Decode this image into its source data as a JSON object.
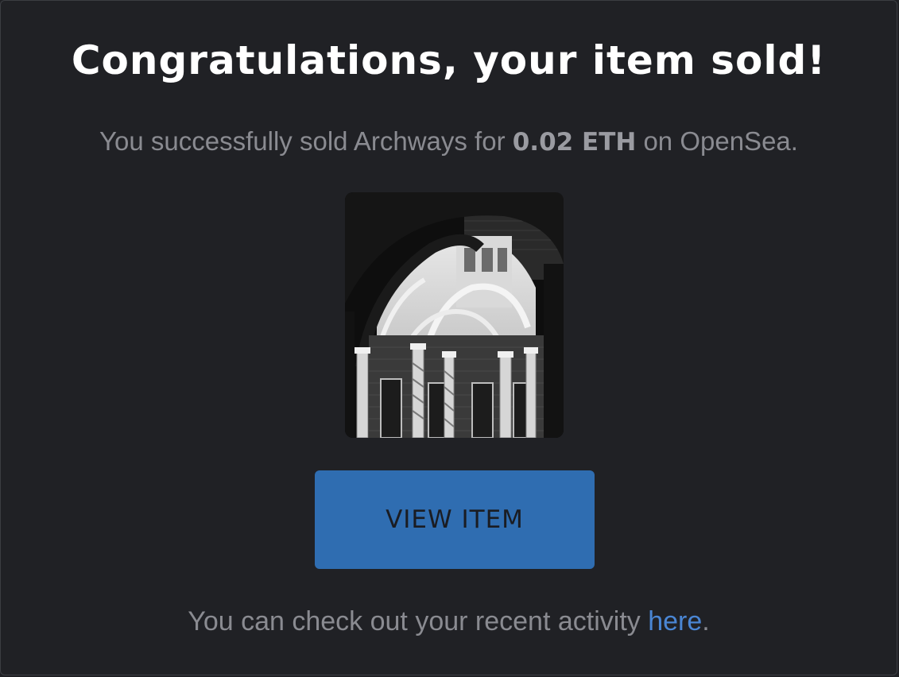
{
  "dialog": {
    "title": "Congratulations, your item sold!",
    "subtitle_prefix": "You successfully sold Archways for ",
    "price": "0.02 ETH",
    "subtitle_suffix": " on OpenSea.",
    "item_image_icon": "archways-photo",
    "view_button_label": "VIEW ITEM",
    "footer_prefix": "You can check out your recent activity ",
    "footer_link": "here",
    "footer_suffix": "."
  },
  "colors": {
    "background": "#202125",
    "button": "#2f6db1",
    "link": "#4a86d4",
    "title": "#ffffff",
    "muted_text": "#8a8b91"
  }
}
